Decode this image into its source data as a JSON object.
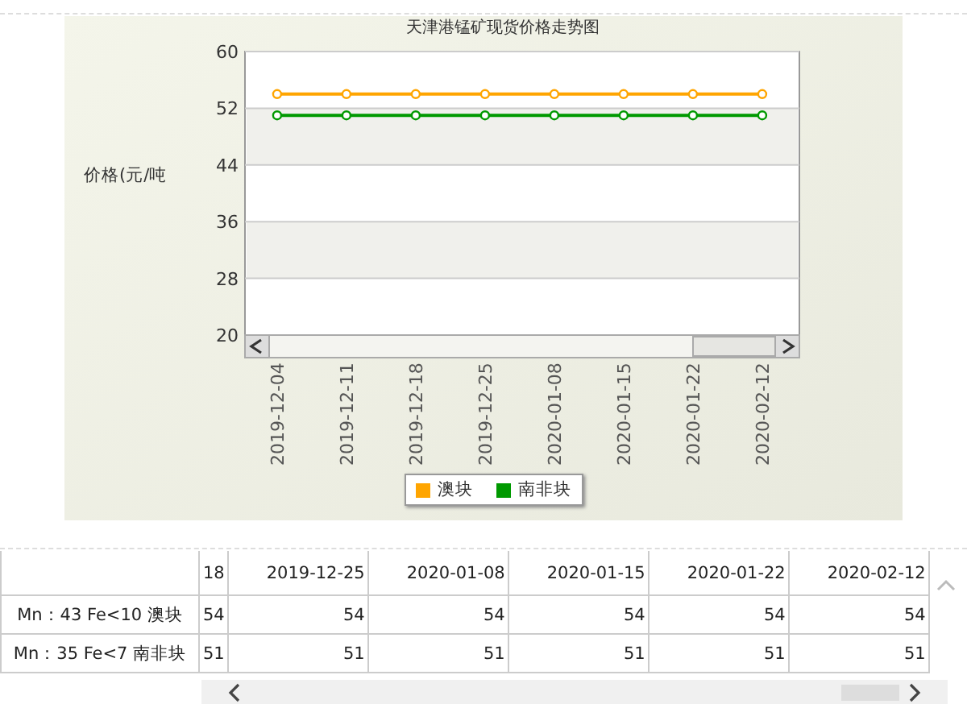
{
  "chart": {
    "title": "天津港锰矿现货价格走势图",
    "chart_data": {
      "type": "line",
      "ylabel": "价格(元/吨",
      "categories": [
        "2019-12-04",
        "2019-12-11",
        "2019-12-18",
        "2019-12-25",
        "2020-01-08",
        "2020-01-15",
        "2020-01-22",
        "2020-02-12"
      ],
      "grid": true,
      "series": [
        {
          "name": "澳块",
          "color": "#ffa500",
          "marker": "circle",
          "values": [
            54,
            54,
            54,
            54,
            54,
            54,
            54,
            54
          ]
        },
        {
          "name": "南非块",
          "color": "#009900",
          "marker": "circle",
          "values": [
            51,
            51,
            51,
            51,
            51,
            51,
            51,
            51
          ]
        }
      ],
      "ylim": [
        20,
        60
      ],
      "yticks": [
        20,
        28,
        36,
        44,
        52,
        60
      ]
    }
  },
  "table": {
    "columns": [
      "18",
      "2019-12-25",
      "2020-01-08",
      "2020-01-15",
      "2020-01-22",
      "2020-02-12"
    ],
    "rows": [
      {
        "label": "Mn：43 Fe<10 澳块",
        "values": [
          "54",
          "54",
          "54",
          "54",
          "54",
          "54"
        ]
      },
      {
        "label": "Mn：35 Fe<7 南非块",
        "values": [
          "51",
          "51",
          "51",
          "51",
          "51",
          "51"
        ]
      }
    ]
  }
}
